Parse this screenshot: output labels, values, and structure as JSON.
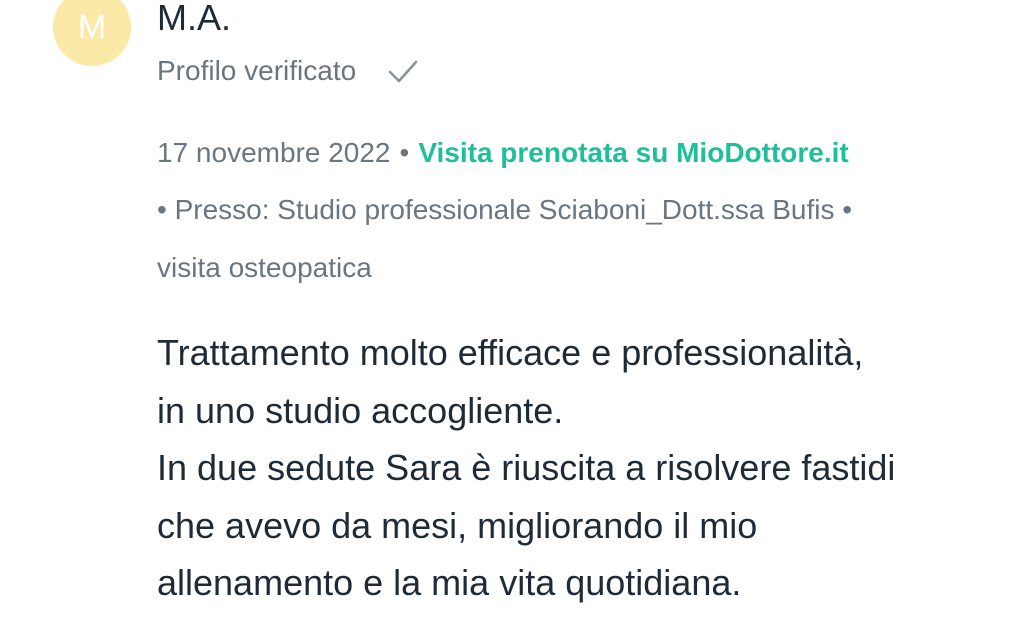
{
  "author": {
    "initial": "M",
    "name": "M.A.",
    "verified_label": "Profilo verificato"
  },
  "visit": {
    "date": "17 novembre 2022",
    "separator": "•",
    "booked_label": "Visita prenotata su MioDottore.it",
    "location": "Presso: Studio professionale Sciaboni_Dott.ssa Bufis",
    "service": "visita osteopatica"
  },
  "comment": {
    "lines": [
      "Trattamento molto efficace e professionalità,",
      "in uno studio accogliente.",
      "In due sedute Sara è riuscita a risolvere fastidi",
      "che avevo da mesi, migliorando il mio",
      "allenamento e la mia vita quotidiana."
    ]
  },
  "colors": {
    "avatar_bg": "#fbe9a8",
    "accent_green": "#1fbf9a",
    "muted_text": "#6b7580",
    "body_text": "#1f2a37"
  },
  "icons": {
    "verified": "check-icon"
  }
}
